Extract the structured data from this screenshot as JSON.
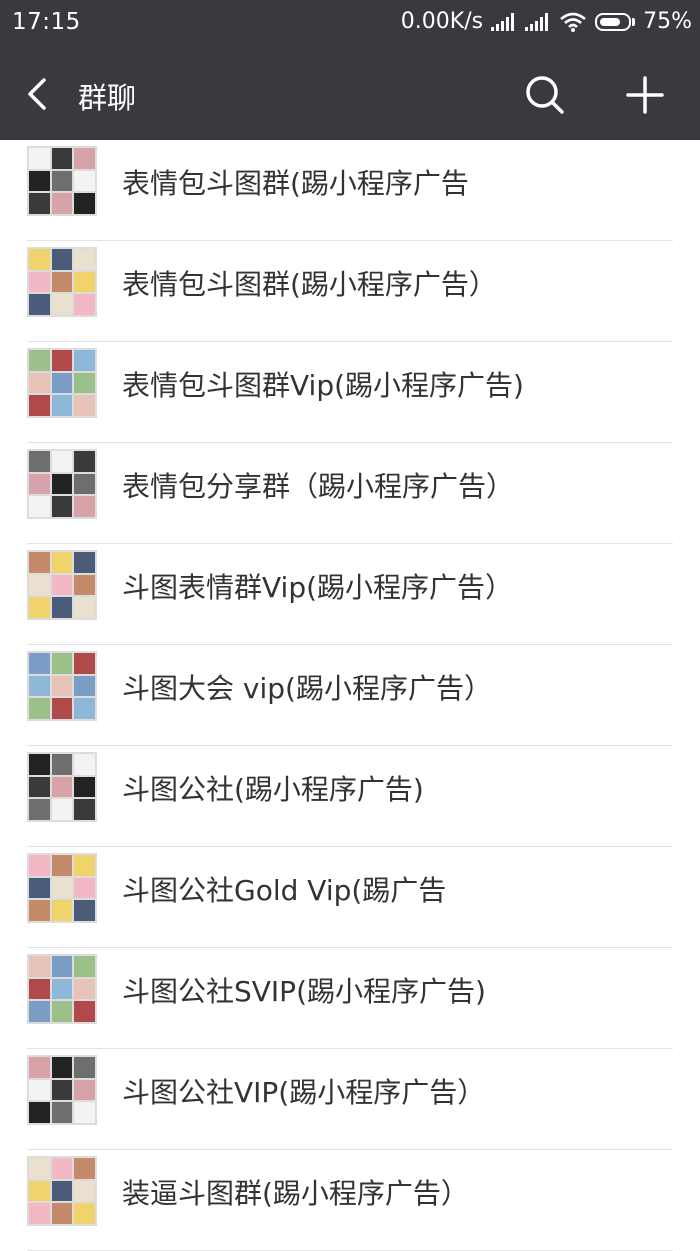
{
  "status_bar": {
    "time": "17:15",
    "network_speed": "0.00K/s",
    "battery_percent": "75%",
    "battery_level": 0.75
  },
  "header": {
    "title": "群聊",
    "back_icon": "chevron-left-icon",
    "search_icon": "search-icon",
    "add_icon": "plus-icon"
  },
  "groups": [
    {
      "name": "表情包斗图群(踢小程序广告",
      "avatar": "grid-avatar"
    },
    {
      "name": "表情包斗图群(踢小程序广告）",
      "avatar": "grid-avatar"
    },
    {
      "name": "表情包斗图群Vip(踢小程序广告)",
      "avatar": "grid-avatar"
    },
    {
      "name": "表情包分享群（踢小程序广告）",
      "avatar": "grid-avatar"
    },
    {
      "name": "斗图表情群Vip(踢小程序广告）",
      "avatar": "grid-avatar"
    },
    {
      "name": "斗图大会  vip(踢小程序广告）",
      "avatar": "grid-avatar"
    },
    {
      "name": "斗图公社(踢小程序广告)",
      "avatar": "grid-avatar"
    },
    {
      "name": "斗图公社Gold Vip(踢广告",
      "avatar": "grid-avatar"
    },
    {
      "name": "斗图公社SVIP(踢小程序广告)",
      "avatar": "grid-avatar"
    },
    {
      "name": "斗图公社VIP(踢小程序广告）",
      "avatar": "grid-avatar"
    },
    {
      "name": "装逼斗图群(踢小程序广告）",
      "avatar": "grid-avatar"
    }
  ],
  "colors": {
    "header_bg": "#393a3f",
    "text": "#333333",
    "divider": "#e3e3e3"
  }
}
